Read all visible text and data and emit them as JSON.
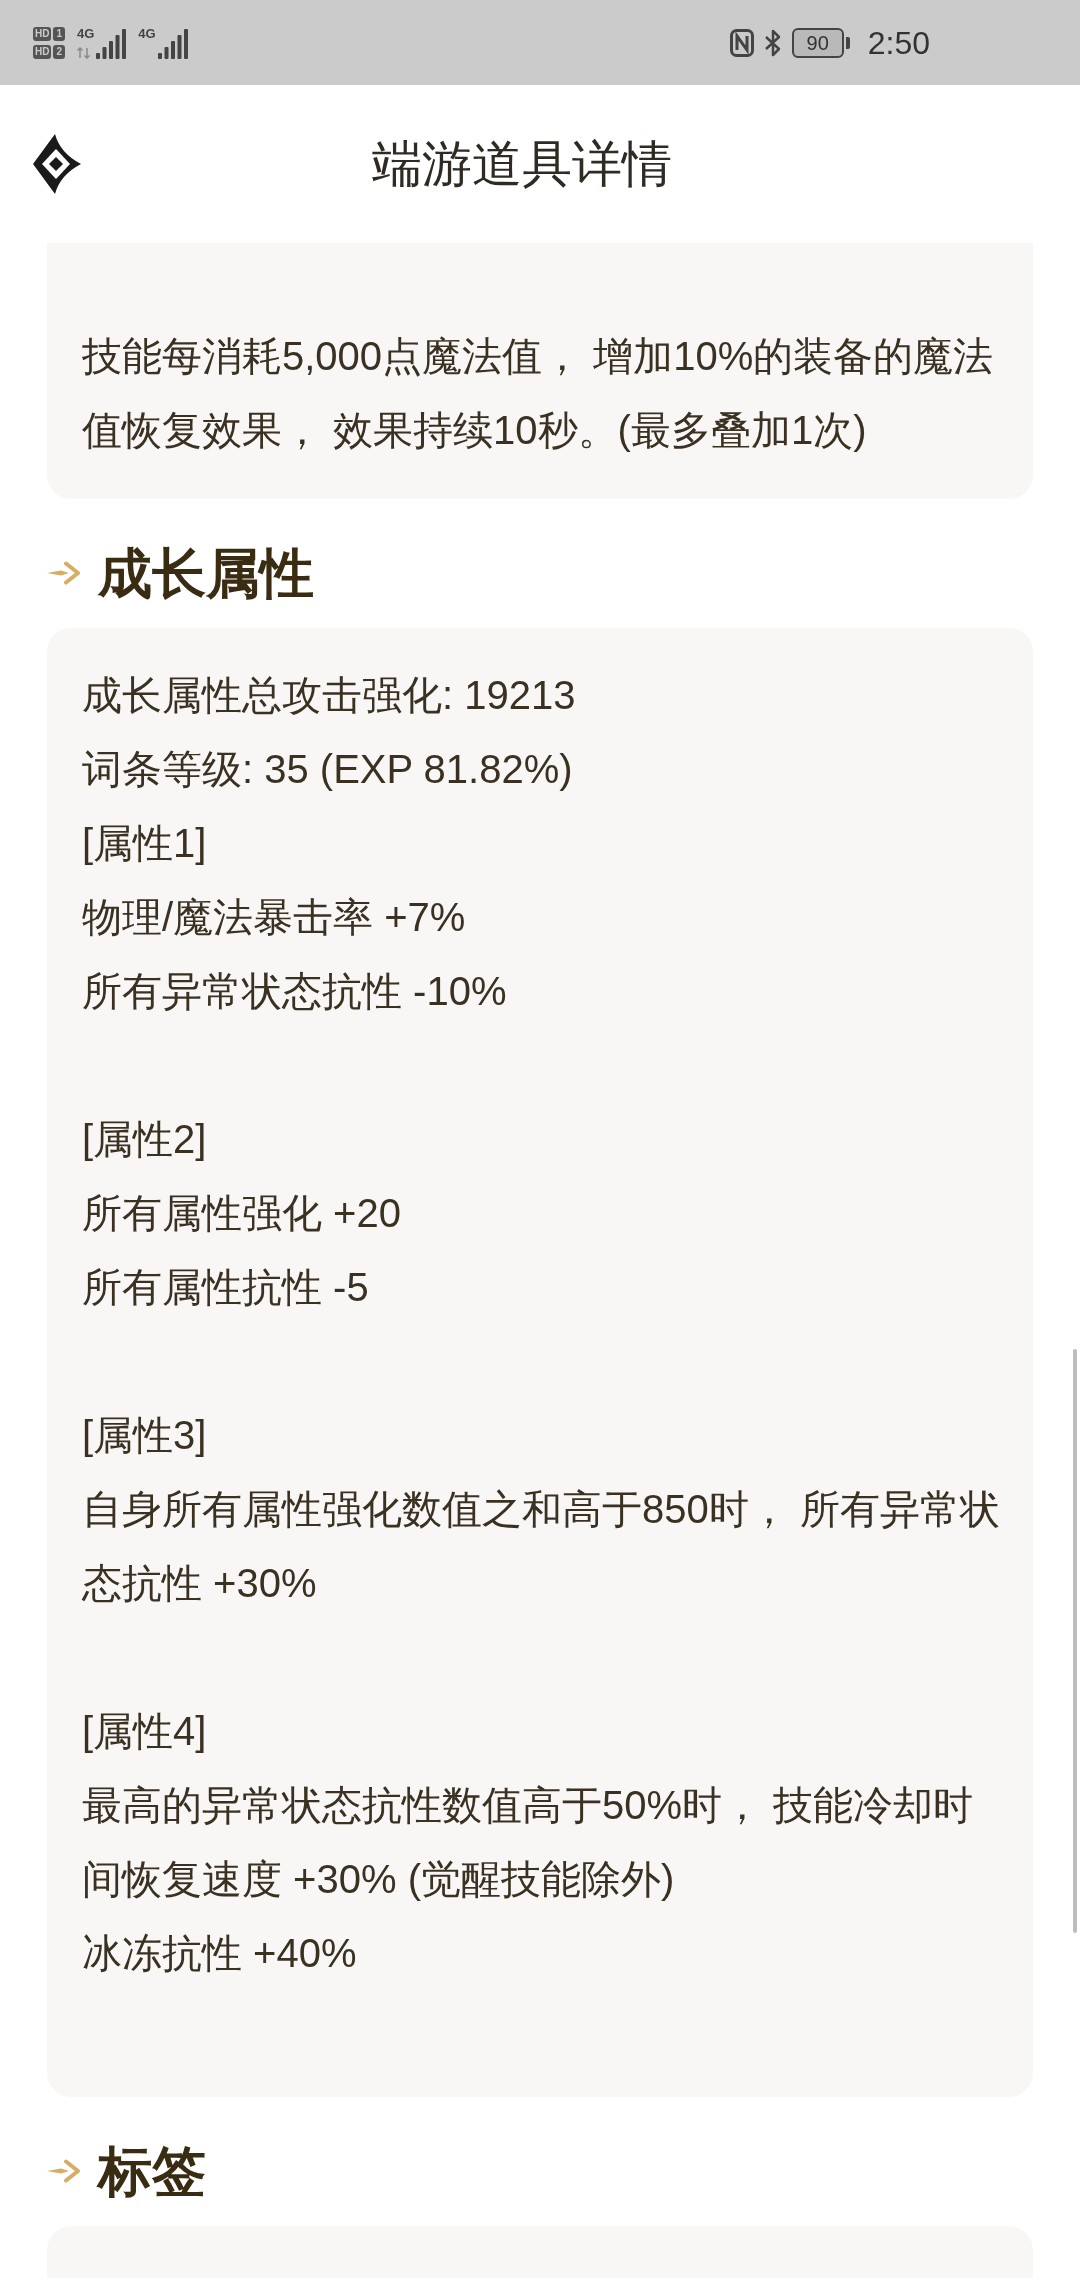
{
  "status_bar": {
    "sims": [
      {
        "badge": "HD",
        "slot": "1",
        "network": "4G"
      },
      {
        "badge": "HD",
        "slot": "2",
        "network": "4G"
      }
    ],
    "battery": {
      "reading": "90"
    },
    "time": "2:50"
  },
  "header": {
    "title": "端游道具详情"
  },
  "effect": {
    "text": "技能每消耗5,000点魔法值， 增加10%的装备的魔法值恢复效果， 效果持续10秒。(最多叠加1次)"
  },
  "growth": {
    "heading": "成长属性",
    "summary": [
      "成长属性总攻击强化: 19213",
      "词条等级: 35 (EXP 81.82%)"
    ],
    "attributes": [
      {
        "name": "[属性1]",
        "lines": [
          "物理/魔法暴击率 +7%",
          "所有异常状态抗性 -10%"
        ]
      },
      {
        "name": "[属性2]",
        "lines": [
          "所有属性强化 +20",
          "所有属性抗性 -5"
        ]
      },
      {
        "name": "[属性3]",
        "lines": [
          "自身所有属性强化数值之和高于850时， 所有异常状态抗性 +30%"
        ]
      },
      {
        "name": "[属性4]",
        "lines": [
          "最高的异常状态抗性数值高于50%时， 技能冷却时间恢复速度 +30% (觉醒技能除外)",
          "冰冻抗性 +40%"
        ]
      }
    ]
  },
  "tags": {
    "heading": "标签"
  }
}
